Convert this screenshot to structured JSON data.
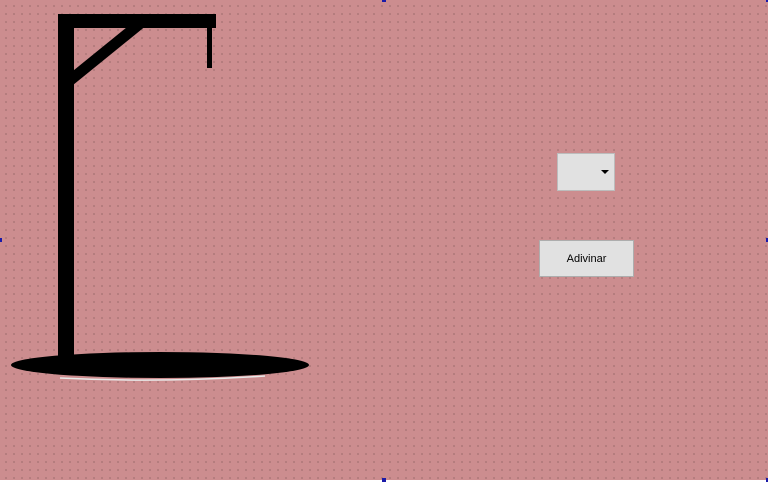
{
  "form": {
    "background": "#cc8d8f",
    "grid_dots": true
  },
  "gallows_image": {
    "icon": "gallows-icon",
    "color": "#000000"
  },
  "letter_select": {
    "value": "",
    "icon": "chevron-down-icon"
  },
  "guess_button": {
    "label": "Adivinar"
  },
  "selection_handles": {
    "color": "#1a1aa8"
  }
}
